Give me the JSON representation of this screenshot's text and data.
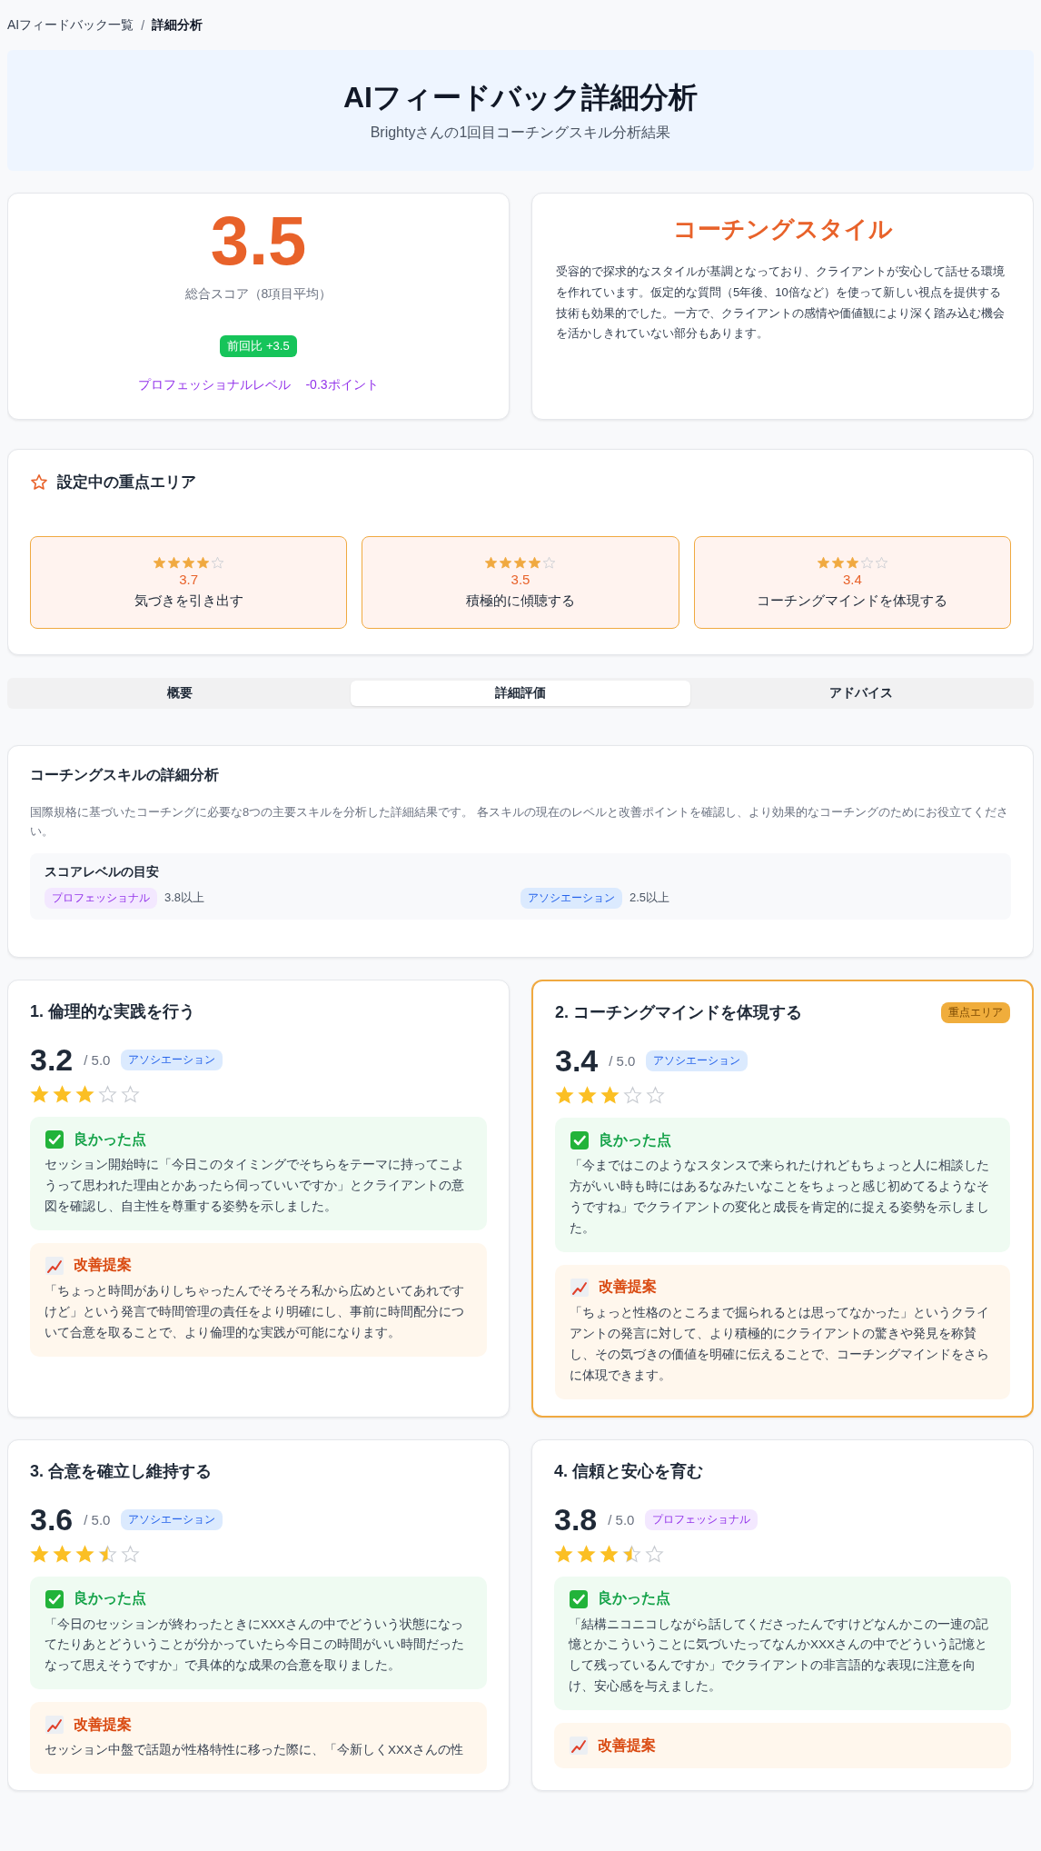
{
  "breadcrumb": {
    "separator": "/",
    "items": [
      {
        "label": "AIフィードバック一覧",
        "current": false
      },
      {
        "label": "詳細分析",
        "current": true
      }
    ]
  },
  "hero": {
    "title": "AIフィードバック詳細分析",
    "subtitle": "Brightyさんの1回目コーチングスキル分析結果"
  },
  "overall": {
    "score": "3.5",
    "label": "総合スコア（8項目平均）",
    "delta": "前回比 +3.5",
    "gap_label": "プロフェッショナルレベル",
    "gap_value": "-0.3ポイント"
  },
  "style": {
    "title": "コーチングスタイル",
    "text": "受容的で探求的なスタイルが基調となっており、クライアントが安心して話せる環境を作れています。仮定的な質問（5年後、10倍など）を使って新しい視点を提供する技術も効果的でした。一方で、クライアントの感情や価値観により深く踏み込む機会を活かしきれていない部分もあります。"
  },
  "focus_areas": {
    "title": "設定中の重点エリア",
    "items": [
      {
        "stars": 4,
        "score": "3.7",
        "label": "気づきを引き出す"
      },
      {
        "stars": 4,
        "score": "3.5",
        "label": "積極的に傾聴する"
      },
      {
        "stars": 3,
        "score": "3.4",
        "label": "コーチングマインドを体現する"
      }
    ]
  },
  "tabs": [
    {
      "label": "概要",
      "selected": false
    },
    {
      "label": "詳細評価",
      "selected": true
    },
    {
      "label": "アドバイス",
      "selected": false
    }
  ],
  "detail": {
    "title": "コーチングスキルの詳細分析",
    "text": "国際規格に基づいたコーチングに必要な8つの主要スキルを分析した詳細結果です。 各スキルの現在のレベルと改善ポイントを確認し、より効果的なコーチングのためにお役立てください。",
    "guide": {
      "title": "スコアレベルの目安",
      "levels": [
        {
          "kind": "professional",
          "label": "プロフェッショナル",
          "threshold": "3.8以上"
        },
        {
          "kind": "association",
          "label": "アソシエーション",
          "threshold": "2.5以上"
        }
      ]
    }
  },
  "skills": [
    {
      "title": "1. 倫理的な実践を行う",
      "focus": false,
      "score": "3.2",
      "max": "/ 5.0",
      "level": {
        "kind": "association",
        "label": "アソシエーション"
      },
      "stars": 3,
      "good": {
        "title": "良かった点",
        "text": "セッション開始時に「今日このタイミングでそちらをテーマに持ってこようって思われた理由とかあったら伺っていいですか」とクライアントの意図を確認し、自主性を尊重する姿勢を示しました。"
      },
      "improve": {
        "title": "改善提案",
        "text": "「ちょっと時間がありしちゃったんでそろそろ私から広めといてあれですけど」という発言で時間管理の責任をより明確にし、事前に時間配分について合意を取ることで、より倫理的な実践が可能になります。"
      }
    },
    {
      "title": "2. コーチングマインドを体現する",
      "focus": true,
      "focus_label": "重点エリア",
      "score": "3.4",
      "max": "/ 5.0",
      "level": {
        "kind": "association",
        "label": "アソシエーション"
      },
      "stars": 3,
      "good": {
        "title": "良かった点",
        "text": "「今まではこのようなスタンスで来られたけれどもちょっと人に相談した方がいい時も時にはあるなみたいなことをちょっと感じ初めてるようなそうですね」でクライアントの変化と成長を肯定的に捉える姿勢を示しました。"
      },
      "improve": {
        "title": "改善提案",
        "text": "「ちょっと性格のところまで掘られるとは思ってなかった」というクライアントの発言に対して、より積極的にクライアントの驚きや発見を称賛し、その気づきの価値を明確に伝えることで、コーチングマインドをさらに体現できます。"
      }
    },
    {
      "title": "3. 合意を確立し維持する",
      "focus": false,
      "score": "3.6",
      "max": "/ 5.0",
      "level": {
        "kind": "association",
        "label": "アソシエーション"
      },
      "stars": 3.5,
      "good": {
        "title": "良かった点",
        "text": "「今日のセッションが終わったときにXXXさんの中でどういう状態になってたりあとどういうことが分かっていたら今日この時間がいい時間だったなって思えそうですか」で具体的な成果の合意を取りました。"
      },
      "improve": {
        "title": "改善提案",
        "text": "セッション中盤で話題が性格特性に移った際に、「今新しくXXXさんの性"
      }
    },
    {
      "title": "4. 信頼と安心を育む",
      "focus": false,
      "score": "3.8",
      "max": "/ 5.0",
      "level": {
        "kind": "professional",
        "label": "プロフェッショナル"
      },
      "stars": 3.5,
      "good": {
        "title": "良かった点",
        "text": "「結構ニコニコしながら話してくださったんですけどなんかこの一連の記憶とかこういうことに気づいたってなんかXXXさんの中でどういう記憶として残っているんですか」でクライアントの非言語的な表現に注意を向け、安心感を与えました。"
      },
      "improve": {
        "title": "改善提案"
      }
    }
  ]
}
